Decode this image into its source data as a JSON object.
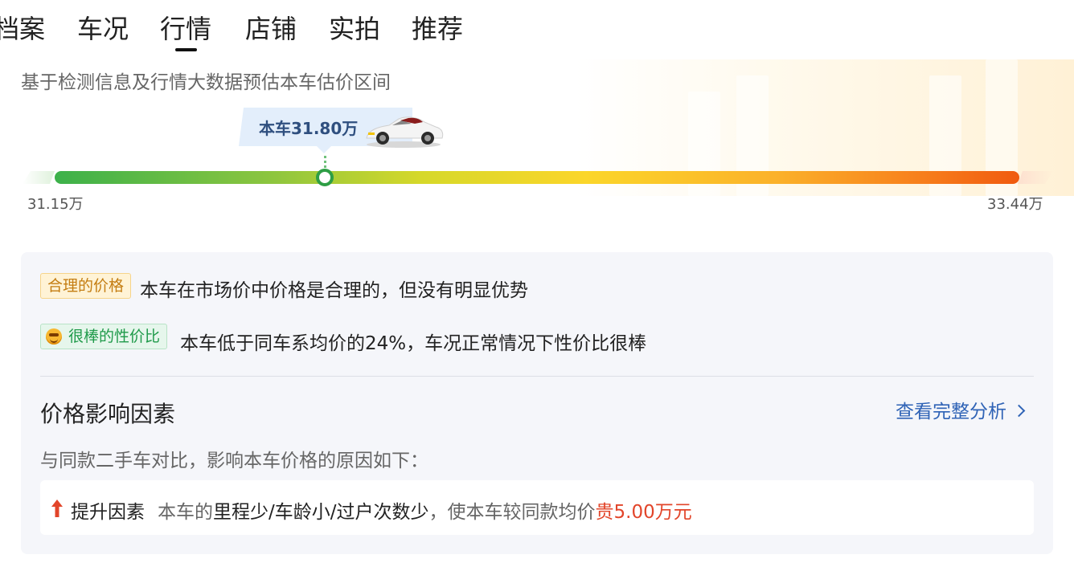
{
  "tabs": [
    {
      "label": "档案"
    },
    {
      "label": "车况"
    },
    {
      "label": "行情"
    },
    {
      "label": "店铺"
    },
    {
      "label": "实拍"
    },
    {
      "label": "推荐"
    }
  ],
  "active_tab": "行情",
  "valuation": {
    "subtitle": "基于检测信息及行情大数据预估本车估价区间",
    "current_price_label": "本车31.80万",
    "range_min": "31.15万",
    "range_max": "33.44万",
    "marker_position_fraction": 0.28
  },
  "analysis": {
    "rows": [
      {
        "badge": "合理的价格",
        "text": "本车在市场价中价格是合理的，但没有明显优势"
      },
      {
        "badge": "很棒的性价比",
        "text": "本车低于同车系均价的24%，车况正常情况下性价比很棒"
      }
    ],
    "factors_title": "价格影响因素",
    "view_full_link": "查看完整分析",
    "factors_desc": "与同款二手车对比，影响本车价格的原因如下：",
    "factor": {
      "label": "提升因素",
      "prefix": "本车的",
      "highlight": "里程少/车龄小/过户次数少",
      "suffix": "，使本车较同款均价",
      "value": "贵5.00万元"
    }
  },
  "colors": {
    "accent_link": "#2f63b6",
    "price_up": "#e2452a",
    "fair_badge": "#c47d12",
    "value_badge": "#1f9a4a"
  },
  "icons": [
    "smile-face-icon",
    "chevron-right-icon",
    "arrow-up-icon",
    "car-image"
  ]
}
